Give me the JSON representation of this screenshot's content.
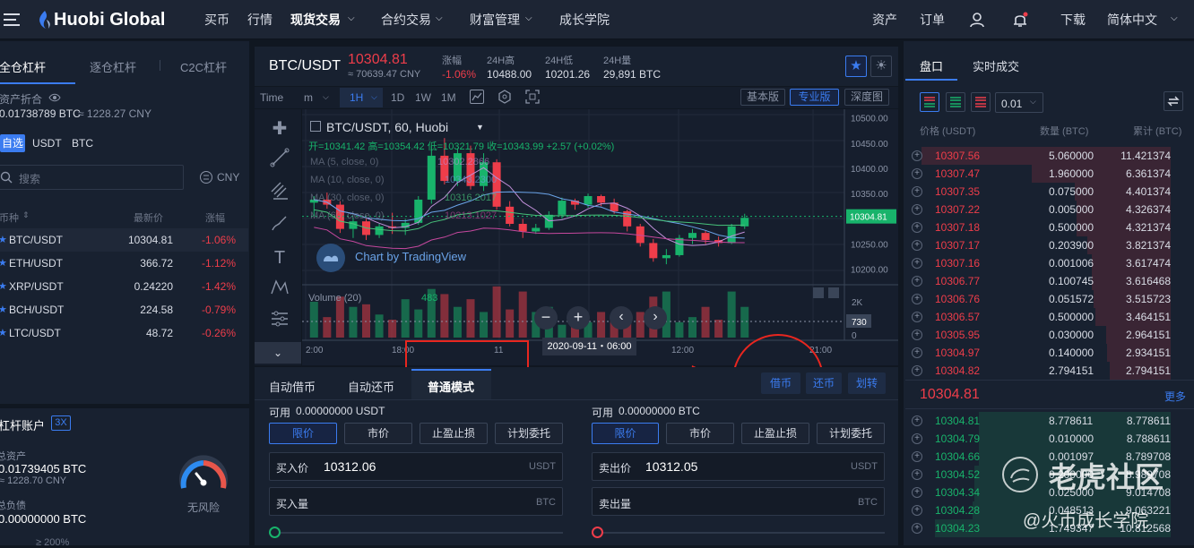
{
  "brand": {
    "name": "Huobi Global"
  },
  "nav": {
    "items": [
      "买币",
      "行情",
      "现货交易",
      "合约交易",
      "财富管理",
      "成长学院"
    ],
    "right": {
      "assets": "资产",
      "orders": "订单",
      "download": "下载",
      "language": "简体中文"
    }
  },
  "left": {
    "tabs": [
      "全仓杠杆",
      "逐仓杠杆",
      "C2C杠杆"
    ],
    "asset_label": "资产折合",
    "asset_value": "0.01738789 BTC",
    "asset_cny": "≈ 1228.27 CNY",
    "filters": [
      "自选",
      "USDT",
      "BTC"
    ],
    "search_placeholder": "搜索",
    "currency": "CNY",
    "columns": [
      "币种",
      "最新价",
      "涨幅"
    ],
    "markets": [
      {
        "pair": "BTC/USDT",
        "price": "10304.81",
        "change": "-1.06%"
      },
      {
        "pair": "ETH/USDT",
        "price": "366.72",
        "change": "-1.12%"
      },
      {
        "pair": "XRP/USDT",
        "price": "0.24220",
        "change": "-1.42%"
      },
      {
        "pair": "BCH/USDT",
        "price": "224.58",
        "change": "-0.79%"
      },
      {
        "pair": "LTC/USDT",
        "price": "48.72",
        "change": "-0.26%"
      }
    ],
    "account": {
      "title": "杠杆账户",
      "leverage": "3X",
      "total_label": "总资产",
      "total_value": "0.01739405 BTC",
      "total_cny": "≈ 1228.70 CNY",
      "debt_label": "总负债",
      "debt_value": "0.00000000 BTC",
      "risk_label": "无风险",
      "risk_rate": "≥ 200%"
    }
  },
  "ticker": {
    "pair": "BTC/USDT",
    "price": "10304.81",
    "price_cny": "≈ 70639.47 CNY",
    "change_label": "涨幅",
    "change": "-1.06%",
    "high_label": "24H高",
    "high": "10488.00",
    "low_label": "24H低",
    "low": "10201.26",
    "vol_label": "24H量",
    "vol": "29,891 BTC"
  },
  "chart_toolbar": {
    "time": "Time",
    "m": "m",
    "intervals": [
      "1H",
      "1D",
      "1W",
      "1M"
    ],
    "views": [
      "基本版",
      "专业版",
      "深度图"
    ]
  },
  "chart": {
    "symbol": "BTC/USDT, 60, Huobi",
    "ohlc": "开=10341.42 高=10354.42 低=10321.79 收=10343.99 +2.57 (+0.02%)",
    "ma": [
      "MA (5, close, 0)",
      "MA (10, close, 0)",
      "MA (30, close, 0)",
      "MA (60, close, 0)"
    ],
    "ma_values": [
      "10302.2866",
      "10343.2300",
      "10316.2017",
      "10213.1027"
    ],
    "watermark": "Chart by TradingView",
    "volume_label": "Volume (20)",
    "volume_value": "483",
    "price_ticks": [
      "10500.00",
      "10450.00",
      "10400.00",
      "10350.00",
      "10304.81",
      "10250.00",
      "10200.00"
    ],
    "vol_ticks": [
      "2K",
      "730",
      "0"
    ],
    "time_ticks": [
      "2:00",
      "18:00",
      "11",
      "12:00",
      "21:00"
    ],
    "crosshair_time": "2020-09-11・06:00"
  },
  "chart_data": {
    "type": "candlestick",
    "ylim": [
      10180,
      10510
    ],
    "candles": [
      [
        10332,
        10345,
        10305,
        10338
      ],
      [
        10338,
        10352,
        10320,
        10328
      ],
      [
        10328,
        10335,
        10272,
        10280
      ],
      [
        10280,
        10302,
        10262,
        10295
      ],
      [
        10295,
        10300,
        10258,
        10268
      ],
      [
        10268,
        10290,
        10262,
        10285
      ],
      [
        10285,
        10312,
        10270,
        10282
      ],
      [
        10282,
        10300,
        10268,
        10292
      ],
      [
        10292,
        10345,
        10288,
        10338
      ],
      [
        10338,
        10445,
        10330,
        10425
      ],
      [
        10425,
        10460,
        10368,
        10375
      ],
      [
        10375,
        10440,
        10365,
        10430
      ],
      [
        10430,
        10445,
        10358,
        10365
      ],
      [
        10365,
        10430,
        10355,
        10412
      ],
      [
        10412,
        10418,
        10318,
        10324
      ],
      [
        10324,
        10335,
        10285,
        10290
      ],
      [
        10290,
        10300,
        10262,
        10275
      ],
      [
        10275,
        10290,
        10270,
        10282
      ],
      [
        10282,
        10315,
        10278,
        10308
      ],
      [
        10308,
        10342,
        10300,
        10336
      ],
      [
        10336,
        10340,
        10318,
        10328
      ],
      [
        10328,
        10350,
        10322,
        10345
      ],
      [
        10345,
        10348,
        10325,
        10332
      ],
      [
        10332,
        10340,
        10310,
        10315
      ],
      [
        10315,
        10318,
        10275,
        10285
      ],
      [
        10285,
        10290,
        10245,
        10252
      ],
      [
        10252,
        10260,
        10215,
        10222
      ],
      [
        10222,
        10240,
        10210,
        10228
      ],
      [
        10228,
        10268,
        10225,
        10262
      ],
      [
        10262,
        10280,
        10250,
        10272
      ],
      [
        10272,
        10276,
        10250,
        10258
      ],
      [
        10258,
        10265,
        10245,
        10252
      ],
      [
        10252,
        10290,
        10250,
        10285
      ],
      [
        10285,
        10310,
        10280,
        10302
      ]
    ],
    "volume": [
      1400,
      800,
      1600,
      1200,
      1300,
      900,
      700,
      1500,
      1100,
      1900,
      1700,
      1200,
      1500,
      1000,
      2000,
      1100,
      1800,
      1000,
      1200,
      500,
      900,
      600,
      1000,
      700,
      900,
      1000,
      1600,
      1800,
      600,
      800,
      1200,
      700,
      1800,
      1200
    ]
  },
  "order_tabs": [
    "自动借币",
    "自动还币",
    "普通模式"
  ],
  "order_actions": [
    "借币",
    "还币",
    "划转"
  ],
  "buy": {
    "available_label": "可用",
    "available": "0.00000000 USDT",
    "types": [
      "限价",
      "市价",
      "止盈止损",
      "计划委托"
    ],
    "price_label": "买入价",
    "price": "10312.06",
    "price_unit": "USDT",
    "amount_label": "买入量",
    "amount_unit": "BTC"
  },
  "sell": {
    "available_label": "可用",
    "available": "0.00000000 BTC",
    "types": [
      "限价",
      "市价",
      "止盈止损",
      "计划委托"
    ],
    "price_label": "卖出价",
    "price": "10312.05",
    "price_unit": "USDT",
    "amount_label": "卖出量",
    "amount_unit": "BTC"
  },
  "orderbook": {
    "tabs": [
      "盘口",
      "实时成交"
    ],
    "precision": "0.01",
    "columns": [
      "价格 (USDT)",
      "数量 (BTC)",
      "累计 (BTC)"
    ],
    "asks": [
      {
        "price": "10307.56",
        "amount": "5.060000",
        "total": "11.421374"
      },
      {
        "price": "10307.47",
        "amount": "1.960000",
        "total": "6.361374"
      },
      {
        "price": "10307.35",
        "amount": "0.075000",
        "total": "4.401374"
      },
      {
        "price": "10307.22",
        "amount": "0.005000",
        "total": "4.326374"
      },
      {
        "price": "10307.18",
        "amount": "0.500000",
        "total": "4.321374"
      },
      {
        "price": "10307.17",
        "amount": "0.203900",
        "total": "3.821374"
      },
      {
        "price": "10307.16",
        "amount": "0.001006",
        "total": "3.617474"
      },
      {
        "price": "10306.77",
        "amount": "0.100745",
        "total": "3.616468"
      },
      {
        "price": "10306.76",
        "amount": "0.051572",
        "total": "3.515723"
      },
      {
        "price": "10306.57",
        "amount": "0.500000",
        "total": "3.464151"
      },
      {
        "price": "10305.95",
        "amount": "0.030000",
        "total": "2.964151"
      },
      {
        "price": "10304.97",
        "amount": "0.140000",
        "total": "2.934151"
      },
      {
        "price": "10304.82",
        "amount": "2.794151",
        "total": "2.794151"
      }
    ],
    "last_price": "10304.81",
    "more": "更多",
    "bids": [
      {
        "price": "10304.81",
        "amount": "8.778611",
        "total": "8.778611"
      },
      {
        "price": "10304.79",
        "amount": "0.010000",
        "total": "8.788611"
      },
      {
        "price": "10304.66",
        "amount": "0.001097",
        "total": "8.789708"
      },
      {
        "price": "10304.52",
        "amount": "0.200000",
        "total": "8.989708"
      },
      {
        "price": "10304.34",
        "amount": "0.025000",
        "total": "9.014708"
      },
      {
        "price": "10304.28",
        "amount": "0.048513",
        "total": "9.063221"
      },
      {
        "price": "10304.23",
        "amount": "1.749347",
        "total": "10.812568"
      }
    ]
  },
  "watermark": {
    "title": "老虎社区",
    "subtitle": "@火币成长学院"
  },
  "colors": {
    "up": "#18b36b",
    "down": "#ee3d4a",
    "accent": "#3b7cf0",
    "annotation": "#e8261f"
  }
}
